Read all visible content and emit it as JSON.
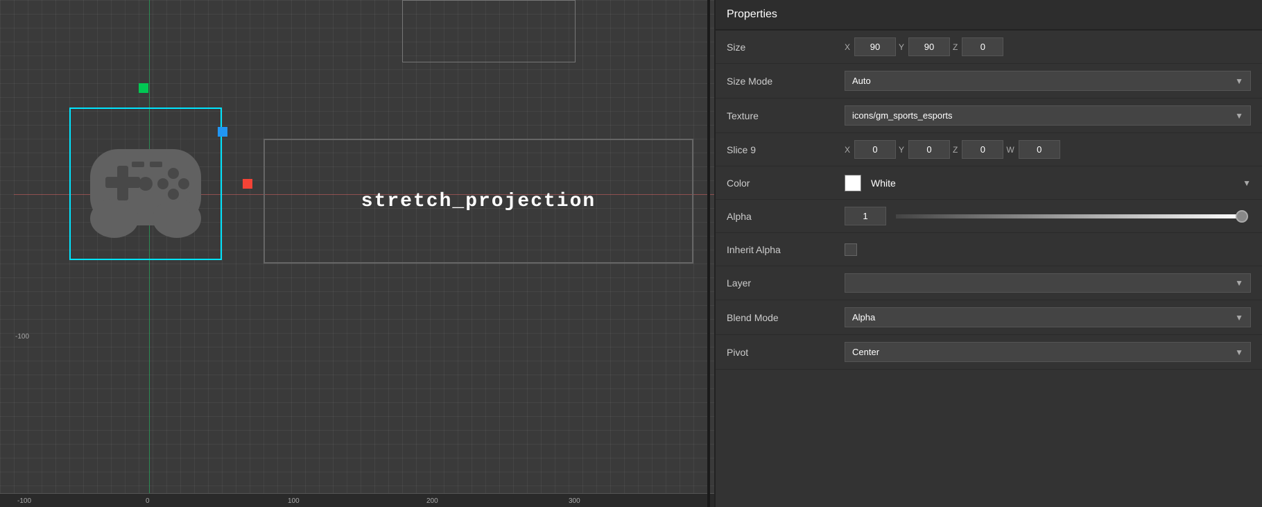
{
  "panel": {
    "title": "Properties",
    "size": {
      "label": "Size",
      "x_label": "X",
      "x_value": "90",
      "y_label": "Y",
      "y_value": "90",
      "z_label": "Z",
      "z_value": "0"
    },
    "size_mode": {
      "label": "Size Mode",
      "value": "Auto"
    },
    "texture": {
      "label": "Texture",
      "value": "icons/gm_sports_esports"
    },
    "slice9": {
      "label": "Slice 9",
      "x_label": "X",
      "x_value": "0",
      "y_label": "Y",
      "y_value": "0",
      "z_label": "Z",
      "z_value": "0",
      "w_label": "W",
      "w_value": "0"
    },
    "color": {
      "label": "Color",
      "swatch": "white",
      "value": "White"
    },
    "alpha": {
      "label": "Alpha",
      "value": "1"
    },
    "inherit_alpha": {
      "label": "Inherit Alpha"
    },
    "layer": {
      "label": "Layer",
      "value": ""
    },
    "blend_mode": {
      "label": "Blend Mode",
      "value": "Alpha"
    },
    "pivot": {
      "label": "Pivot",
      "value": "Center"
    }
  },
  "canvas": {
    "stretch_label": "stretch_projection",
    "ruler_ticks_x": [
      "-100",
      "0",
      "100",
      "200",
      "300"
    ],
    "ruler_ticks_y": [
      "-100"
    ]
  }
}
